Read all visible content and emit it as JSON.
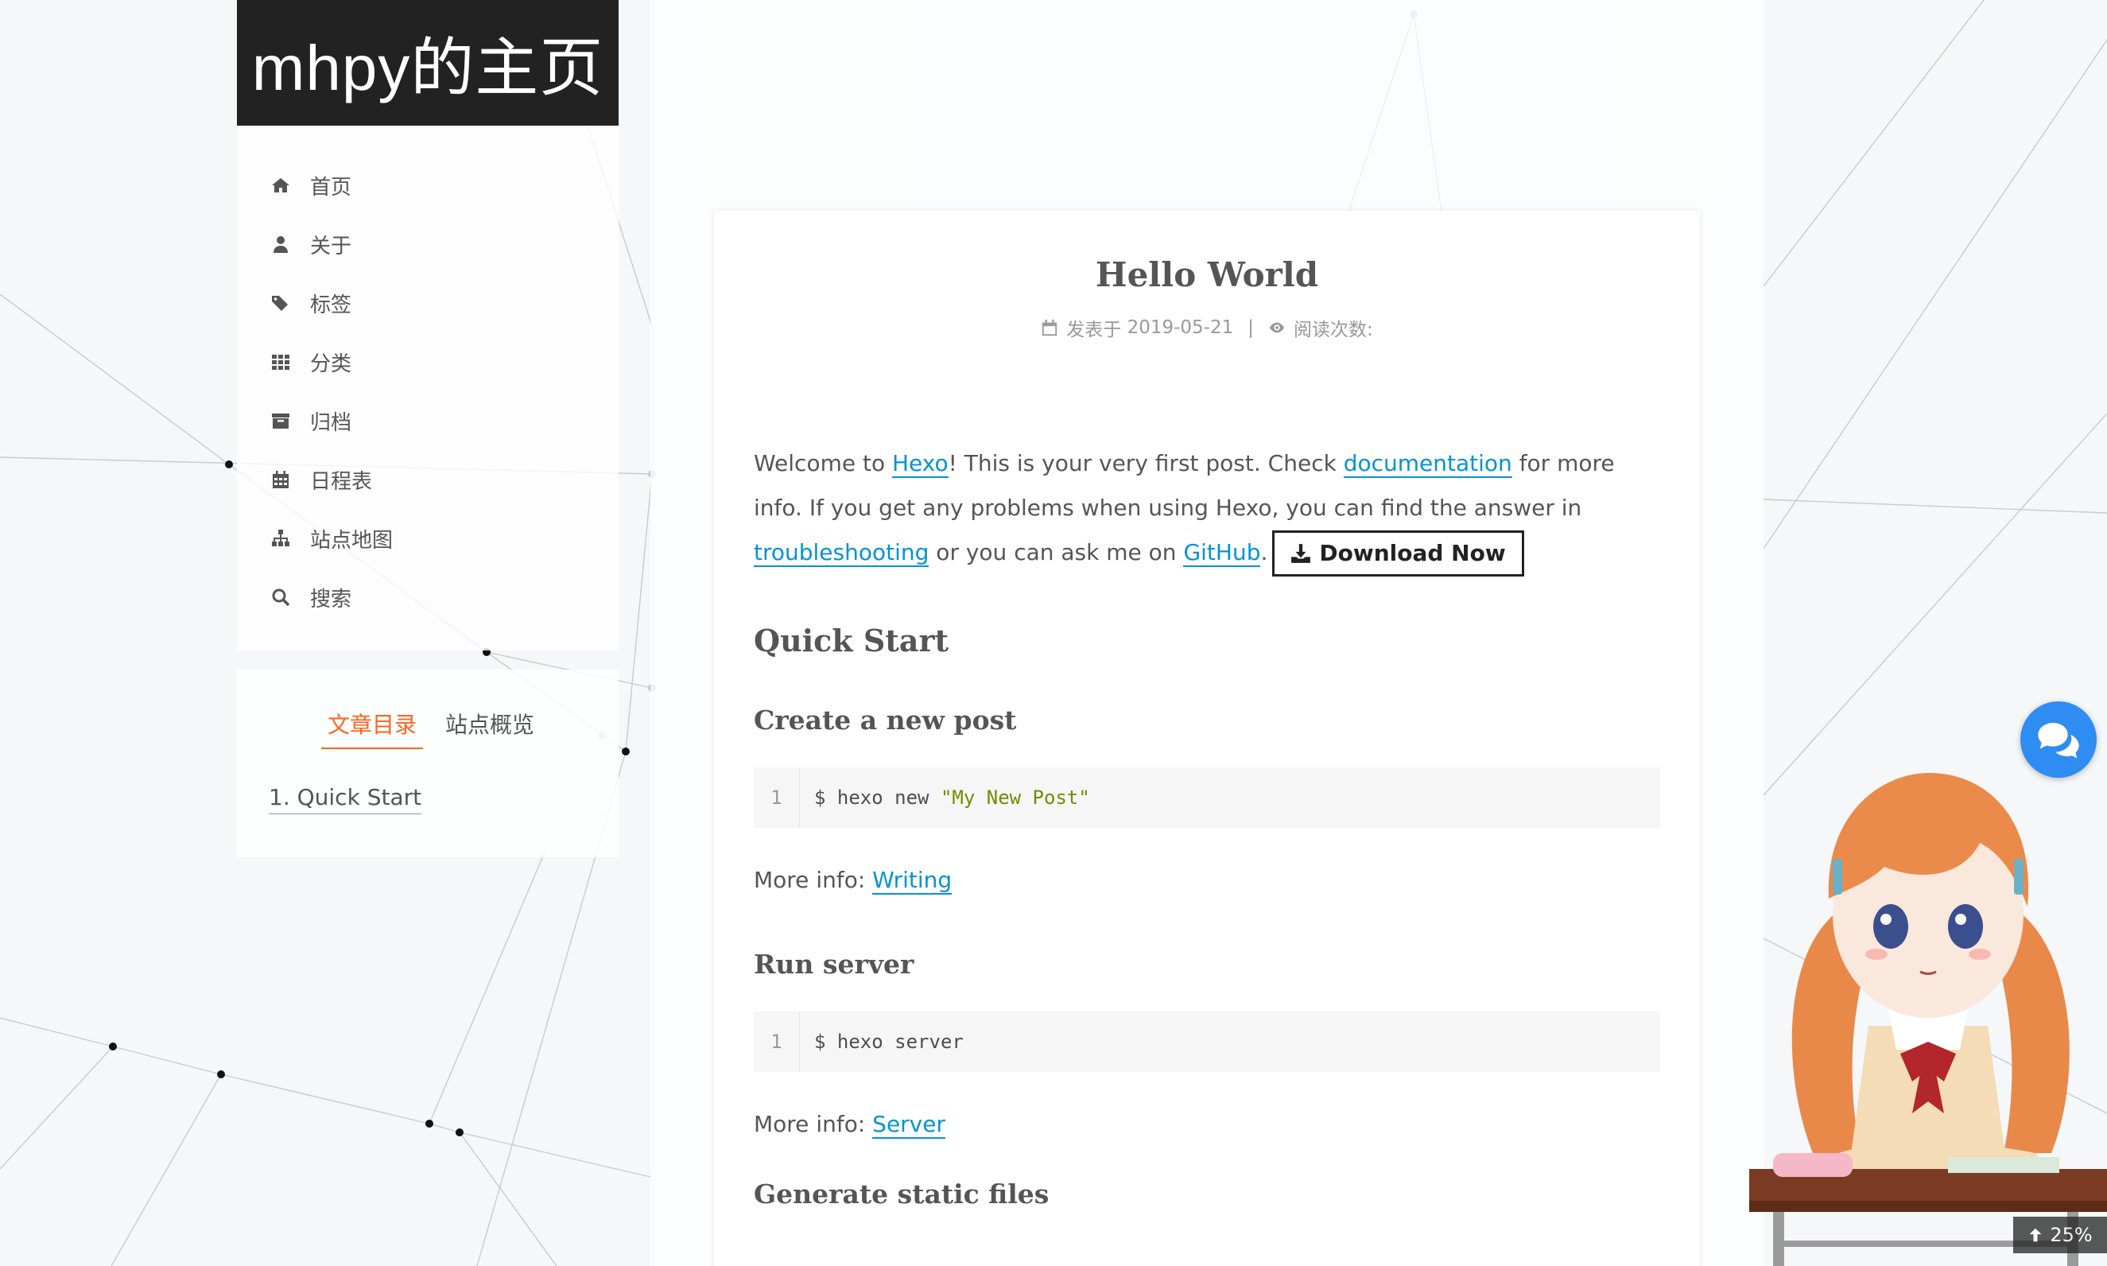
{
  "site": {
    "brand": "mhpy的主页"
  },
  "menu": {
    "items": [
      {
        "label": "首页",
        "icon": "home-icon"
      },
      {
        "label": "关于",
        "icon": "user-icon"
      },
      {
        "label": "标签",
        "icon": "tags-icon"
      },
      {
        "label": "分类",
        "icon": "th-icon"
      },
      {
        "label": "归档",
        "icon": "archive-icon"
      },
      {
        "label": "日程表",
        "icon": "calendar-icon"
      },
      {
        "label": "站点地图",
        "icon": "sitemap-icon"
      },
      {
        "label": "搜索",
        "icon": "search-icon"
      }
    ]
  },
  "sidebar": {
    "tabs": {
      "toc": "文章目录",
      "overview": "站点概览"
    },
    "toc_entry": "1. Quick Start"
  },
  "post": {
    "title": "Hello World",
    "meta": {
      "posted_label": "发表于",
      "date": "2019-05-21",
      "sep": "|",
      "views_label": "阅读次数:"
    },
    "intro": {
      "t1": "Welcome to ",
      "link_hexo": "Hexo",
      "t2": "! This is your very first post. Check ",
      "link_docs": "documentation",
      "t3": " for more info. If you get any problems when using Hexo, you can find the answer in ",
      "link_trouble": "troubleshooting",
      "t4": " or you can ask me on ",
      "link_github": "GitHub",
      "t5": ".",
      "download": "Download Now"
    },
    "quick_start": "Quick Start",
    "sections": [
      {
        "heading": "Create a new post",
        "line_no": "1",
        "cmd": "$ hexo new ",
        "str": "\"My New Post\"",
        "info_label": "More info: ",
        "info_link": "Writing"
      },
      {
        "heading": "Run server",
        "line_no": "1",
        "cmd": "$ hexo server",
        "str": "",
        "info_label": "More info: ",
        "info_link": "Server"
      }
    ],
    "next_heading": "Generate static files"
  },
  "widgets": {
    "back_to_top": "25%"
  },
  "colors": {
    "accent": "#fc6423",
    "link": "#0593d3",
    "brand_bg": "#222222",
    "chat": "#2f8cf3"
  }
}
